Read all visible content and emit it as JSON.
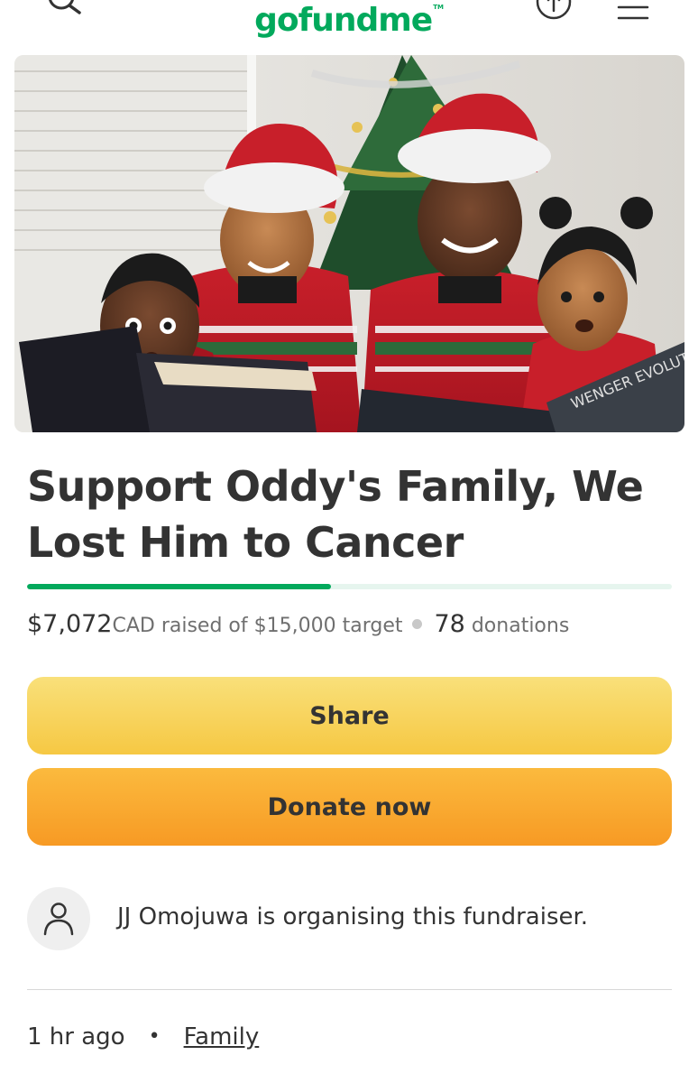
{
  "header": {
    "logo_text": "gofundme",
    "logo_tm": "TM",
    "icons": [
      "search-icon",
      "upload-icon",
      "menu-icon"
    ]
  },
  "hero": {
    "image": "family-christmas-photo",
    "book_text": "WENGER EVOLUTION"
  },
  "campaign": {
    "title": "Support Oddy's Family, We Lost Him to Cancer",
    "raised_amount": "$7,072",
    "raised_text": "CAD raised of $15,000 target",
    "donations_count": "78",
    "donations_label": "donations",
    "progress_fraction": 0.4715
  },
  "buttons": {
    "share_label": "Share",
    "donate_label": "Donate now"
  },
  "organiser": {
    "text": "JJ Omojuwa is organising this fundraiser."
  },
  "meta": {
    "time": "1 hr ago",
    "category": "Family"
  },
  "colors": {
    "brand": "#02a95c",
    "share_button": "#f7d35a",
    "donate_button": "#f8a933",
    "progress_track": "#e6f5ee"
  }
}
